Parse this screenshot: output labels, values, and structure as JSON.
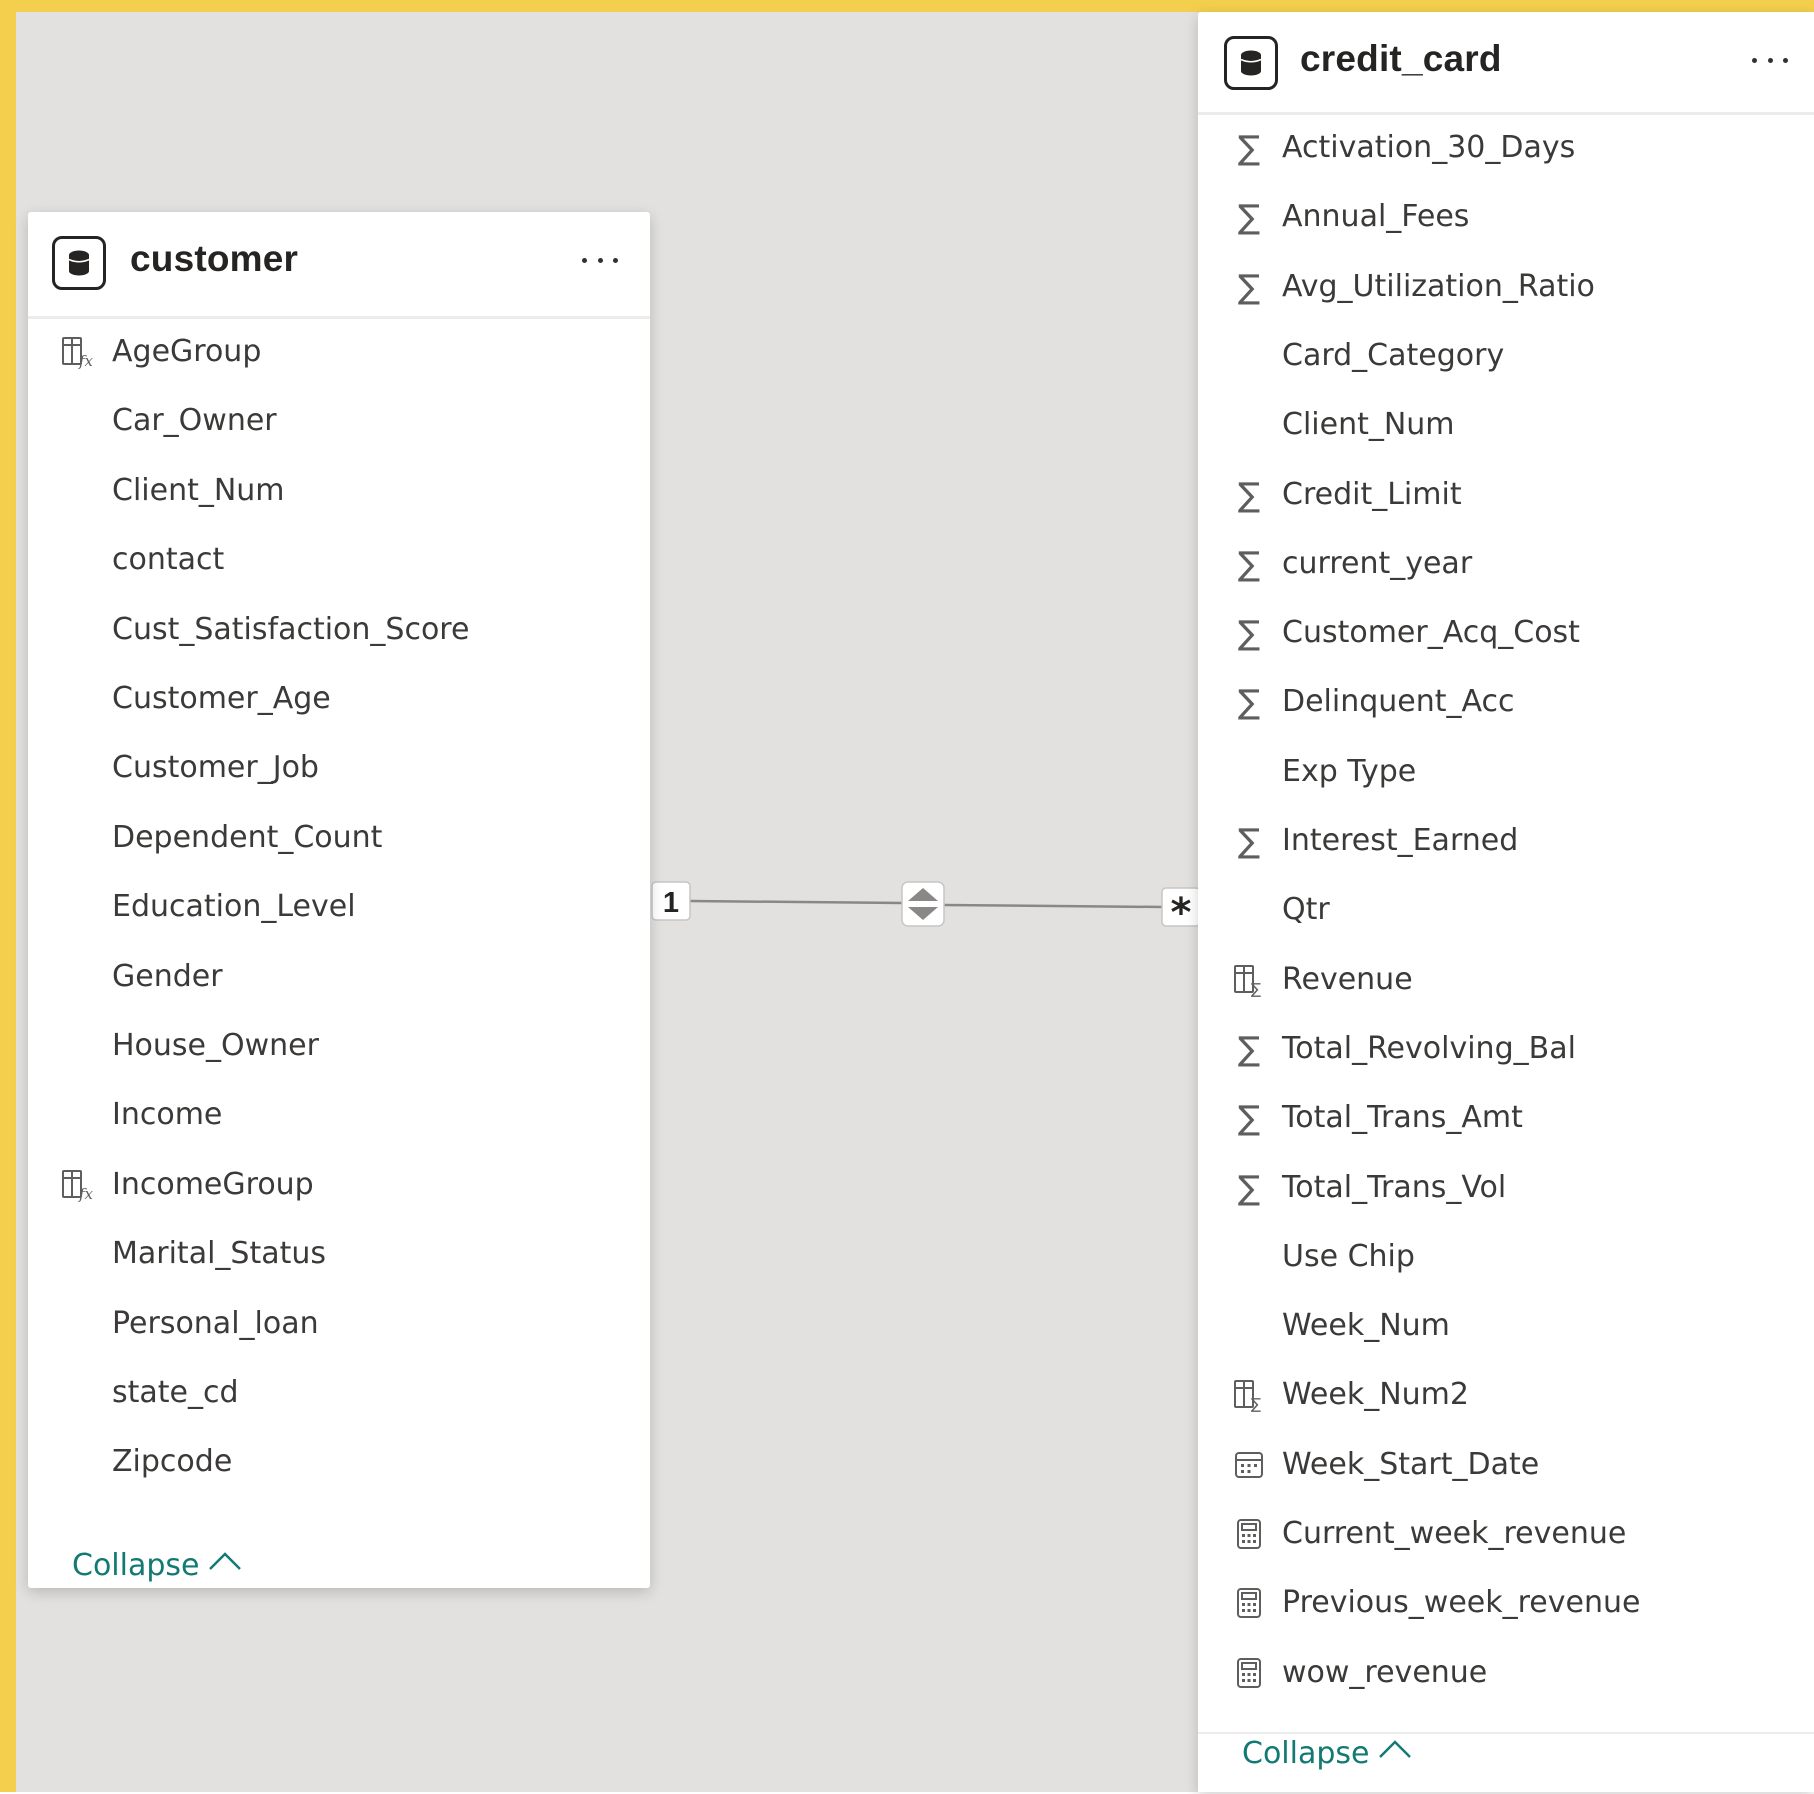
{
  "canvas": {
    "frame_color": "#f3cf4d",
    "background_color": "#e2e1df",
    "accent_color": "#127a73"
  },
  "tables": {
    "customer": {
      "title": "customer",
      "header_icon": "database-icon",
      "more_icon": "more-options-icon",
      "fields": [
        {
          "label": "AgeGroup",
          "icon": "calculated-column-icon"
        },
        {
          "label": "Car_Owner",
          "icon": ""
        },
        {
          "label": "Client_Num",
          "icon": ""
        },
        {
          "label": "contact",
          "icon": ""
        },
        {
          "label": "Cust_Satisfaction_Score",
          "icon": ""
        },
        {
          "label": "Customer_Age",
          "icon": ""
        },
        {
          "label": "Customer_Job",
          "icon": ""
        },
        {
          "label": "Dependent_Count",
          "icon": ""
        },
        {
          "label": "Education_Level",
          "icon": ""
        },
        {
          "label": "Gender",
          "icon": ""
        },
        {
          "label": "House_Owner",
          "icon": ""
        },
        {
          "label": "Income",
          "icon": ""
        },
        {
          "label": "IncomeGroup",
          "icon": "calculated-column-icon"
        },
        {
          "label": "Marital_Status",
          "icon": ""
        },
        {
          "label": "Personal_loan",
          "icon": ""
        },
        {
          "label": "state_cd",
          "icon": ""
        },
        {
          "label": "Zipcode",
          "icon": ""
        }
      ],
      "collapse_label": "Collapse"
    },
    "credit_card": {
      "title": "credit_card",
      "header_icon": "database-icon",
      "more_icon": "more-options-icon",
      "fields": [
        {
          "label": "Activation_30_Days",
          "icon": "sigma-icon"
        },
        {
          "label": "Annual_Fees",
          "icon": "sigma-icon"
        },
        {
          "label": "Avg_Utilization_Ratio",
          "icon": "sigma-icon"
        },
        {
          "label": "Card_Category",
          "icon": ""
        },
        {
          "label": "Client_Num",
          "icon": ""
        },
        {
          "label": "Credit_Limit",
          "icon": "sigma-icon"
        },
        {
          "label": "current_year",
          "icon": "sigma-icon"
        },
        {
          "label": "Customer_Acq_Cost",
          "icon": "sigma-icon"
        },
        {
          "label": "Delinquent_Acc",
          "icon": "sigma-icon"
        },
        {
          "label": "Exp Type",
          "icon": ""
        },
        {
          "label": "Interest_Earned",
          "icon": "sigma-icon"
        },
        {
          "label": "Qtr",
          "icon": ""
        },
        {
          "label": "Revenue",
          "icon": "calculated-sigma-column-icon"
        },
        {
          "label": "Total_Revolving_Bal",
          "icon": "sigma-icon"
        },
        {
          "label": "Total_Trans_Amt",
          "icon": "sigma-icon"
        },
        {
          "label": "Total_Trans_Vol",
          "icon": "sigma-icon"
        },
        {
          "label": "Use Chip",
          "icon": ""
        },
        {
          "label": "Week_Num",
          "icon": ""
        },
        {
          "label": "Week_Num2",
          "icon": "calculated-sigma-column-icon"
        },
        {
          "label": "Week_Start_Date",
          "icon": "calendar-icon"
        },
        {
          "label": "Current_week_revenue",
          "icon": "calculator-icon"
        },
        {
          "label": "Previous_week_revenue",
          "icon": "calculator-icon"
        },
        {
          "label": "wow_revenue",
          "icon": "calculator-icon"
        }
      ],
      "collapse_label": "Collapse"
    }
  },
  "relationship": {
    "from_table": "customer",
    "to_table": "credit_card",
    "one_side_label": "1",
    "many_side_label": "*",
    "cross_filter_icon": "bidirectional-filter-icon"
  }
}
